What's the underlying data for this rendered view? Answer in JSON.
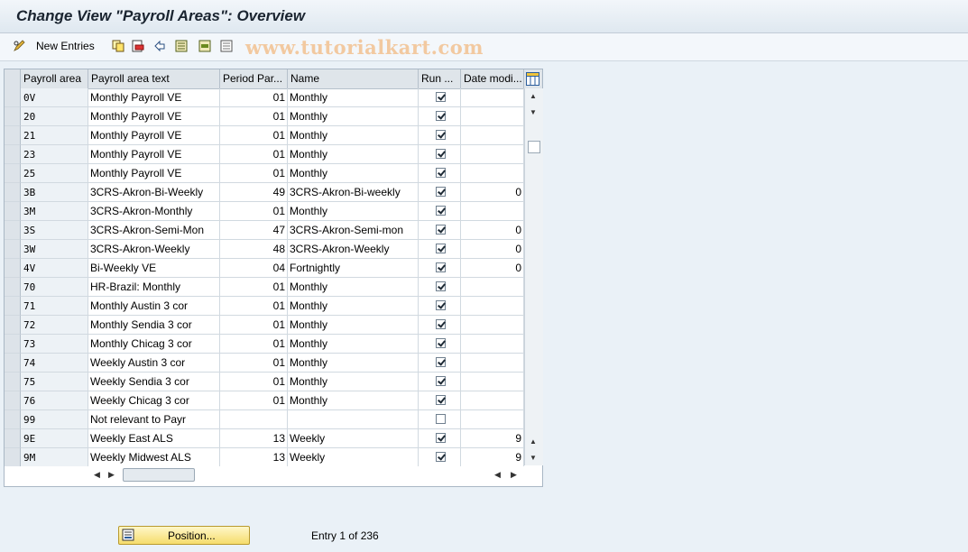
{
  "title": "Change View \"Payroll Areas\": Overview",
  "toolbar": {
    "new_entries": "New Entries"
  },
  "watermark": "www.tutorialkart.com",
  "table": {
    "headers": [
      "Payroll area",
      "Payroll area text",
      "Period Par...",
      "Name",
      "Run ...",
      "Date modi..."
    ],
    "rows": [
      {
        "area": "0V",
        "text": "Monthly Payroll  VE",
        "period": "01",
        "name": "Monthly",
        "run": true,
        "date": ""
      },
      {
        "area": "20",
        "text": "Monthly Payroll  VE",
        "period": "01",
        "name": "Monthly",
        "run": true,
        "date": ""
      },
      {
        "area": "21",
        "text": "Monthly Payroll  VE",
        "period": "01",
        "name": "Monthly",
        "run": true,
        "date": ""
      },
      {
        "area": "23",
        "text": "Monthly Payroll  VE",
        "period": "01",
        "name": "Monthly",
        "run": true,
        "date": ""
      },
      {
        "area": "25",
        "text": "Monthly Payroll  VE",
        "period": "01",
        "name": "Monthly",
        "run": true,
        "date": ""
      },
      {
        "area": "3B",
        "text": "3CRS-Akron-Bi-Weekly",
        "period": "49",
        "name": "3CRS-Akron-Bi-weekly",
        "run": true,
        "date": "0"
      },
      {
        "area": "3M",
        "text": "3CRS-Akron-Monthly",
        "period": "01",
        "name": "Monthly",
        "run": true,
        "date": ""
      },
      {
        "area": "3S",
        "text": "3CRS-Akron-Semi-Mon",
        "period": "47",
        "name": "3CRS-Akron-Semi-mon",
        "run": true,
        "date": "0"
      },
      {
        "area": "3W",
        "text": "3CRS-Akron-Weekly",
        "period": "48",
        "name": "3CRS-Akron-Weekly",
        "run": true,
        "date": "0"
      },
      {
        "area": "4V",
        "text": "Bi-Weekly VE",
        "period": "04",
        "name": "Fortnightly",
        "run": true,
        "date": "0"
      },
      {
        "area": "70",
        "text": "HR-Brazil: Monthly",
        "period": "01",
        "name": "Monthly",
        "run": true,
        "date": ""
      },
      {
        "area": "71",
        "text": "Monthly Austin 3 cor",
        "period": "01",
        "name": "Monthly",
        "run": true,
        "date": ""
      },
      {
        "area": "72",
        "text": "Monthly Sendia 3 cor",
        "period": "01",
        "name": "Monthly",
        "run": true,
        "date": ""
      },
      {
        "area": "73",
        "text": "Monthly Chicag 3 cor",
        "period": "01",
        "name": "Monthly",
        "run": true,
        "date": ""
      },
      {
        "area": "74",
        "text": "Weekly Austin 3 cor",
        "period": "01",
        "name": "Monthly",
        "run": true,
        "date": ""
      },
      {
        "area": "75",
        "text": "Weekly Sendia 3 cor",
        "period": "01",
        "name": "Monthly",
        "run": true,
        "date": ""
      },
      {
        "area": "76",
        "text": "Weekly Chicag 3 cor",
        "period": "01",
        "name": "Monthly",
        "run": true,
        "date": ""
      },
      {
        "area": "99",
        "text": "Not relevant to Payr",
        "period": "",
        "name": "",
        "run": false,
        "date": ""
      },
      {
        "area": "9E",
        "text": "Weekly East ALS",
        "period": "13",
        "name": "Weekly",
        "run": true,
        "date": "9"
      },
      {
        "area": "9M",
        "text": "Weekly Midwest ALS",
        "period": "13",
        "name": "Weekly",
        "run": true,
        "date": "9"
      }
    ]
  },
  "footer": {
    "position_button": "Position...",
    "entry_info": "Entry 1 of 236"
  },
  "icons": [
    "pencil-glasses-icon",
    "copy-icon",
    "delete-icon",
    "undo-icon",
    "select-all-icon",
    "select-block-icon",
    "deselect-all-icon",
    "table-settings-icon",
    "position-icon"
  ],
  "colors": {
    "background": "#eaf1f7",
    "header": "#dfe5ea",
    "button": "#f5dc6c"
  }
}
